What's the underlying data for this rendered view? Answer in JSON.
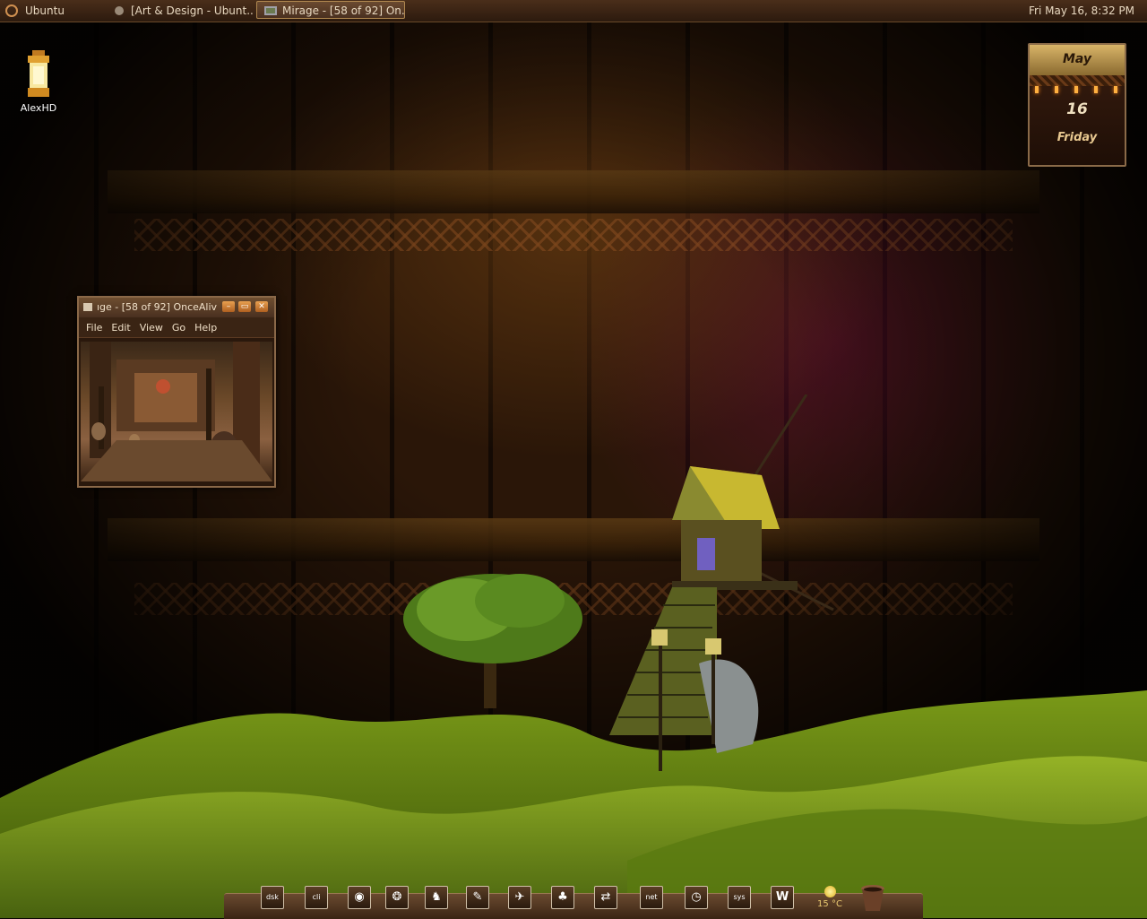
{
  "top_panel": {
    "menu_label": "Ubuntu",
    "tasks": [
      {
        "label": "[Art & Design - Ubunt..."
      },
      {
        "label": "Mirage - [58 of 92] On..."
      }
    ],
    "clock": "Fri May 16,  8:32 PM"
  },
  "desktop": {
    "icons": [
      {
        "label": "AlexHD",
        "icon": "lantern-icon"
      }
    ]
  },
  "calendar": {
    "month": "May",
    "day": "16",
    "weekday": "Friday"
  },
  "mirage_window": {
    "title": "ıge - [58 of 92] OnceAliv",
    "menu": [
      "File",
      "Edit",
      "View",
      "Go",
      "Help"
    ],
    "buttons": [
      "minimize",
      "maximize",
      "close"
    ]
  },
  "dock": {
    "items": [
      {
        "name": "dsk",
        "label": "dsk"
      },
      {
        "name": "cli",
        "label": "cli"
      },
      {
        "name": "firefox",
        "label": ""
      },
      {
        "name": "pidgin",
        "label": ""
      },
      {
        "name": "gimp",
        "label": ""
      },
      {
        "name": "inkscape",
        "label": ""
      },
      {
        "name": "xfce",
        "label": ""
      },
      {
        "name": "clover",
        "label": ""
      },
      {
        "name": "transfer",
        "label": ""
      },
      {
        "name": "net",
        "label": "net"
      },
      {
        "name": "clock",
        "label": ""
      },
      {
        "name": "sys",
        "label": "sys"
      },
      {
        "name": "writer",
        "label": "W"
      }
    ],
    "weather": {
      "temp": "15 °C"
    }
  },
  "colors": {
    "panel": "#3a2414",
    "accent": "#d09050",
    "grass": "#7a9a18"
  }
}
